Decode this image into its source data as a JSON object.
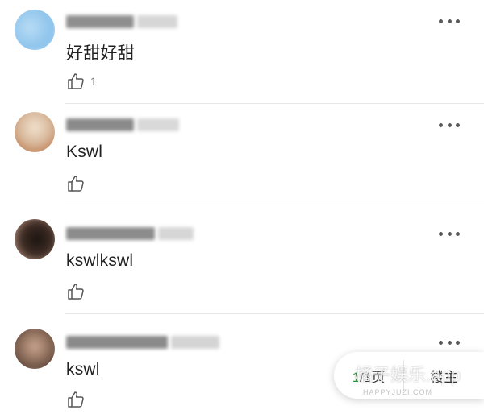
{
  "comments": [
    {
      "text": "好甜好甜",
      "like_count": "1",
      "avatar_color": "#8ec4ec",
      "name_color": "#9a9a9a"
    },
    {
      "text": "Kswl",
      "like_count": "",
      "avatar_color": "#d7b79a",
      "name_color": "#8c8c8c"
    },
    {
      "text": "kswlkswl",
      "like_count": "",
      "avatar_color": "#4a3a34",
      "name_color": "#8c8c8c"
    },
    {
      "text": "kswl",
      "like_count": "",
      "avatar_color": "#8a6a58",
      "name_color": "#8c8c8c"
    }
  ],
  "pager": {
    "current": "1",
    "total_text": "/1页",
    "floor_label": "楼主"
  },
  "icons": {
    "like": "thumbs-up-icon",
    "more": "more-dots-icon"
  },
  "colors": {
    "accent_green": "#2c9a3a",
    "text": "#222222",
    "divider": "#e6e6e6"
  },
  "watermark": {
    "text": "橘子娱乐.app",
    "subtext": "HAPPYJUZI.COM"
  }
}
